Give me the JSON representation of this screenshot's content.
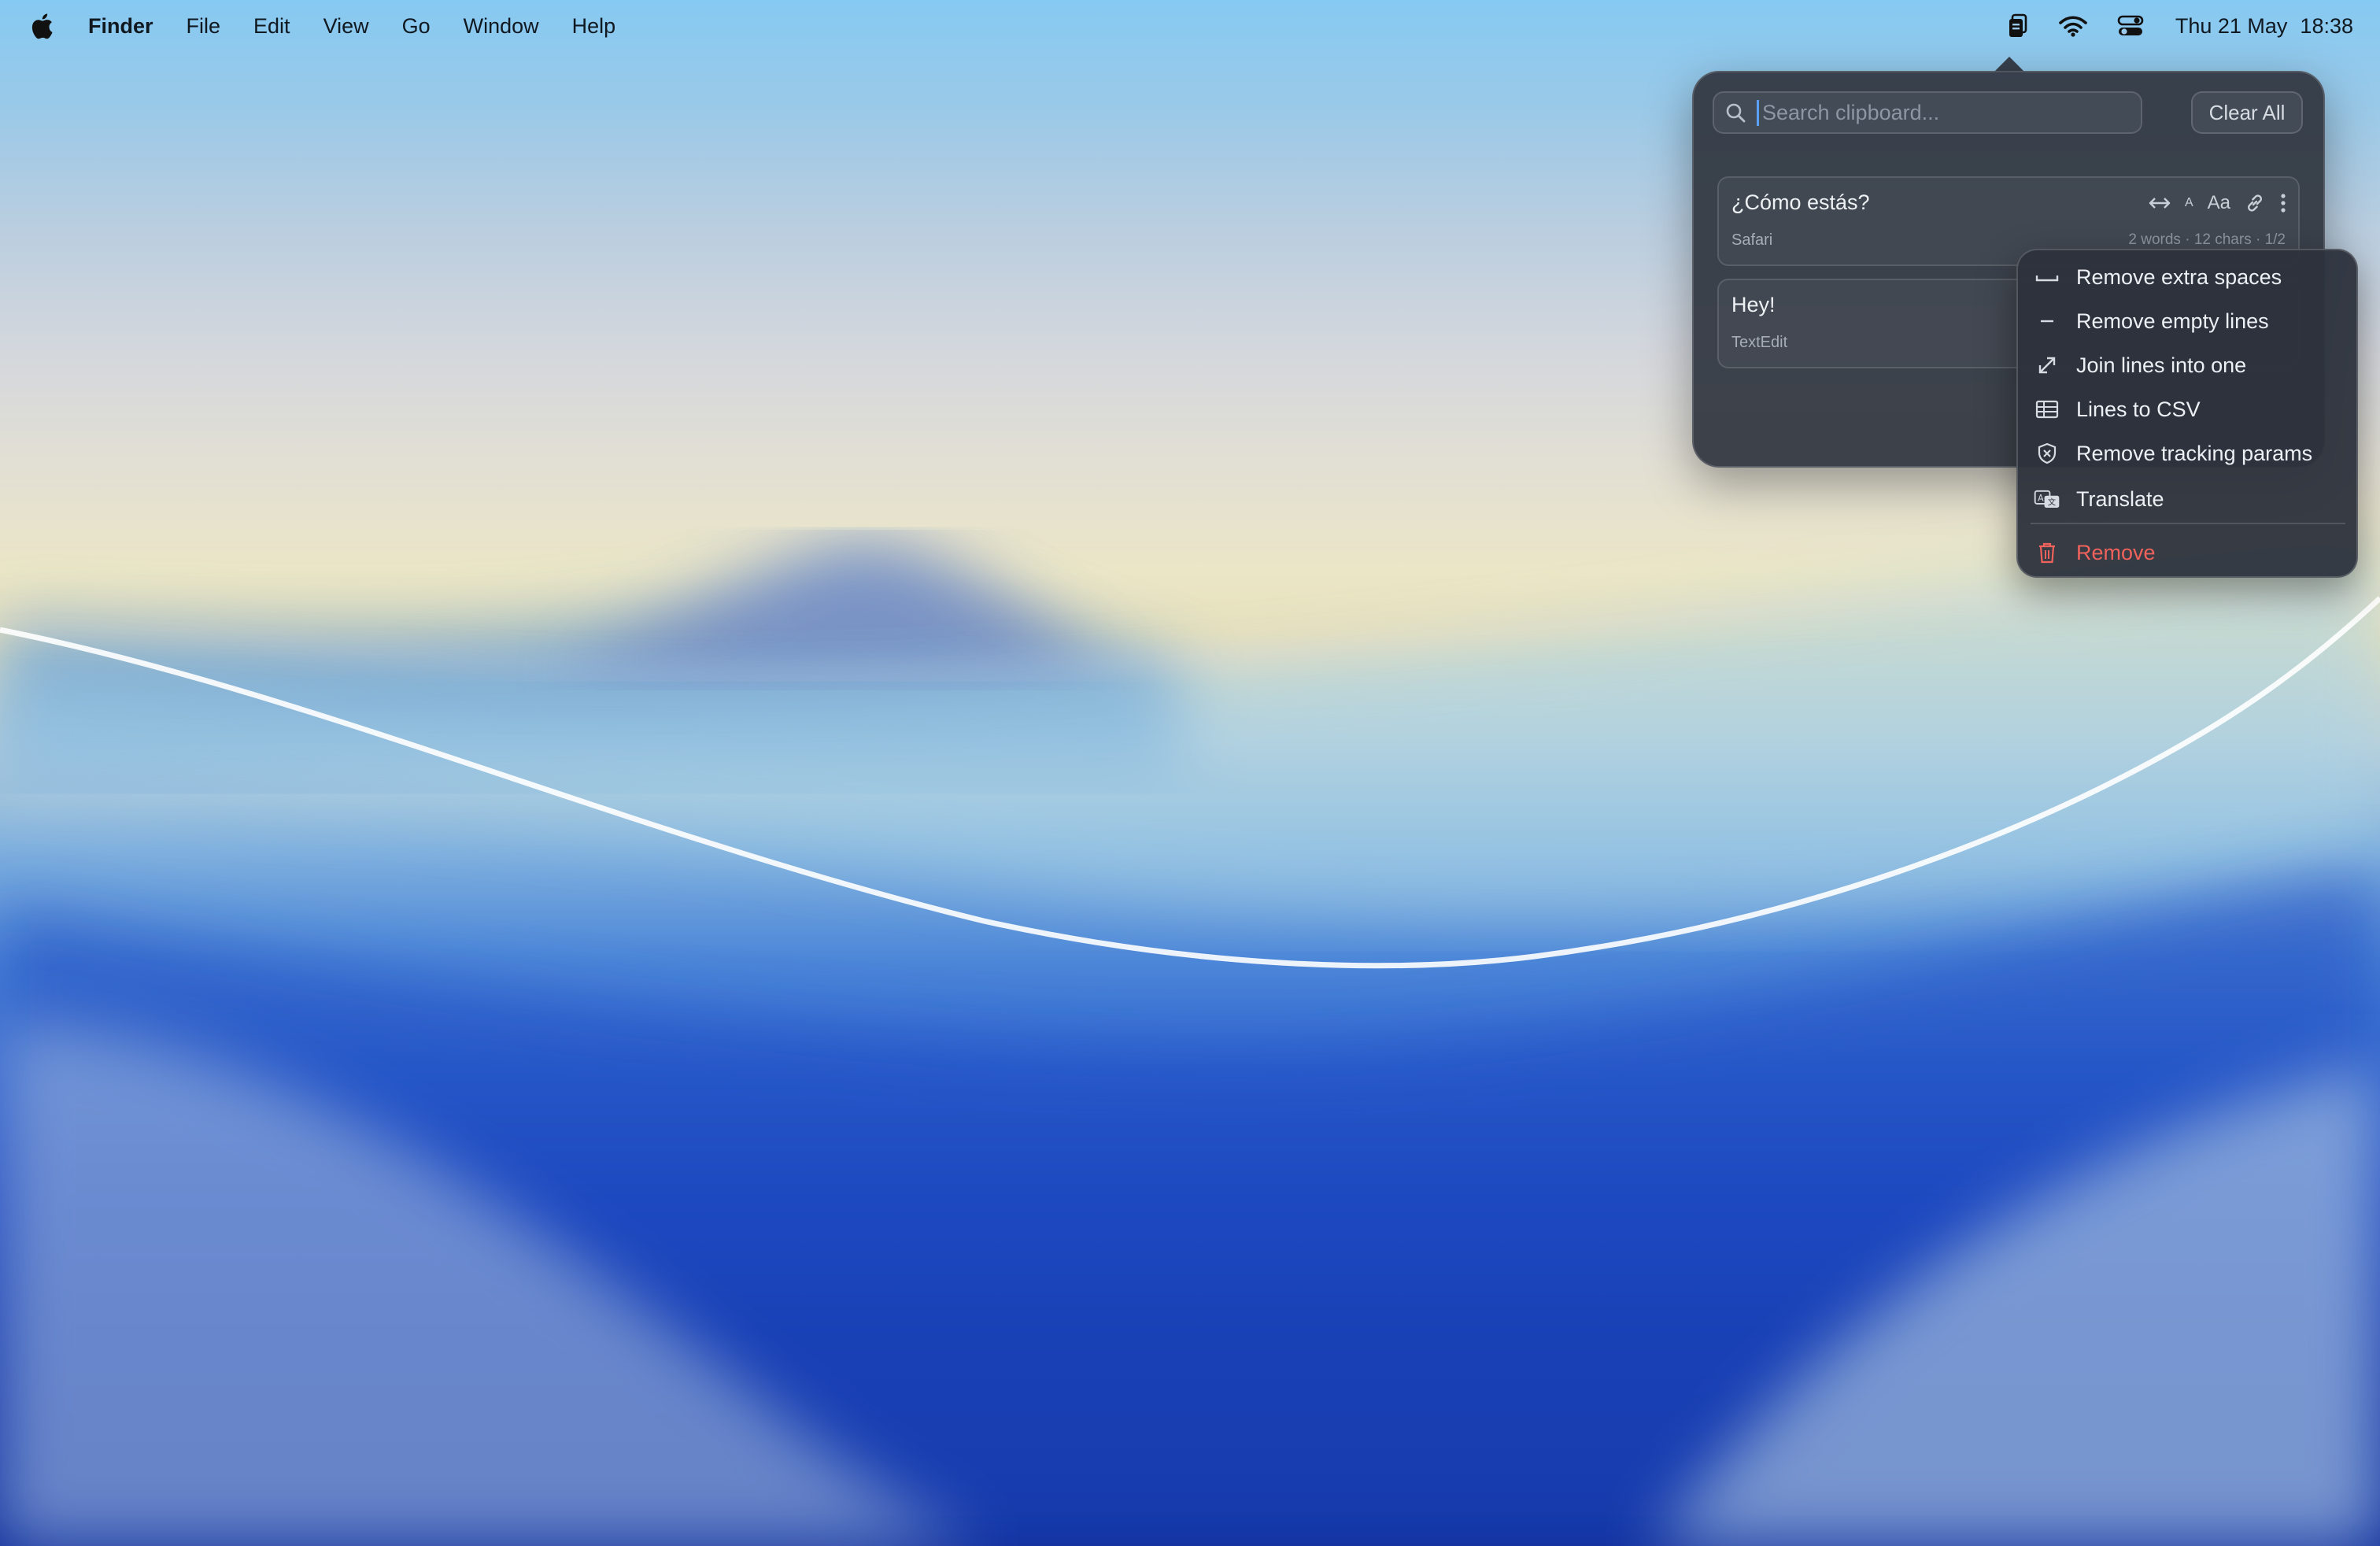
{
  "menubar": {
    "app_name": "Finder",
    "menus": [
      "File",
      "Edit",
      "View",
      "Go",
      "Window",
      "Help"
    ],
    "clock_day": "Thu 21 May",
    "clock_time": "18:38"
  },
  "clipboard": {
    "search_placeholder": "Search clipboard...",
    "clear_all_label": "Clear All",
    "items": [
      {
        "text": "¿Cómo estás?",
        "source": "Safari",
        "meta": "2 words · 12 chars · 1/2",
        "actions": {
          "small_a": "A",
          "case": "Aa"
        }
      },
      {
        "text": "Hey!",
        "source": "TextEdit"
      }
    ]
  },
  "context_menu": {
    "items": [
      {
        "label": "Remove extra spaces",
        "icon": "space-icon"
      },
      {
        "label": "Remove empty lines",
        "icon": "dash-icon"
      },
      {
        "label": "Join lines into one",
        "icon": "expand-arrows-icon"
      },
      {
        "label": "Lines to CSV",
        "icon": "table-icon"
      },
      {
        "label": "Remove tracking params",
        "icon": "shield-x-icon"
      },
      {
        "label": "Translate",
        "icon": "translate-icon"
      },
      {
        "label": "Remove",
        "icon": "trash-icon",
        "color": "#f0625c"
      }
    ]
  }
}
